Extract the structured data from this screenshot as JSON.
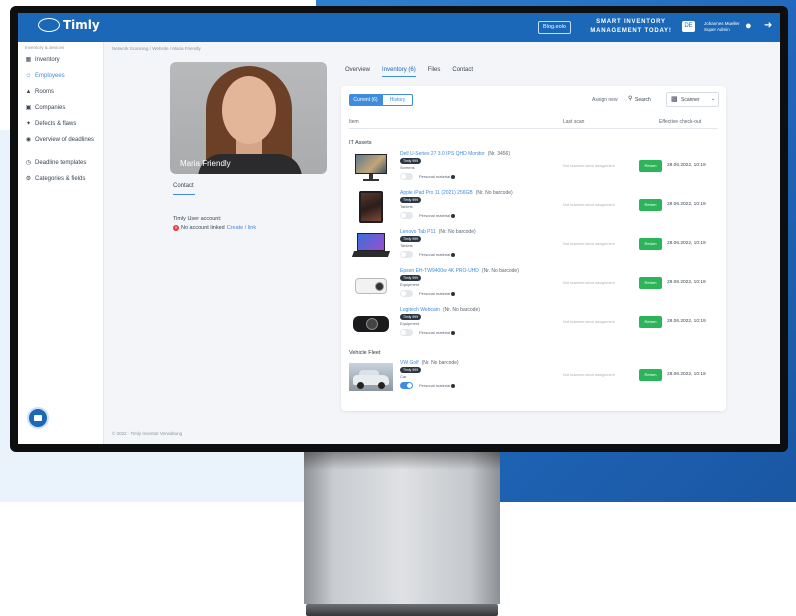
{
  "brand": {
    "name": "Timly",
    "blog_label": "Blog.eolo",
    "tagline": "SMART INVENTORY MANAGEMENT TODAY!",
    "flag": "DE",
    "user_line1": "Johannes Mueller",
    "user_line2": "Super Admin",
    "accent": "#1b67b8",
    "success": "#2bb45a"
  },
  "sidebar": {
    "caption": "Inventory & devices",
    "items": [
      {
        "label": "Inventory",
        "icon": "box-icon"
      },
      {
        "label": "Employees",
        "icon": "employees-icon",
        "active": true
      },
      {
        "label": "Rooms",
        "icon": "room-icon"
      },
      {
        "label": "Companies",
        "icon": "company-icon"
      },
      {
        "label": "Defects & flaws",
        "icon": "wrench-icon"
      },
      {
        "label": "Overview of deadlines",
        "icon": "eye-icon"
      },
      {
        "label": "Deadline templates",
        "icon": "clock-icon"
      },
      {
        "label": "Categories & fields",
        "icon": "gear-icon"
      }
    ]
  },
  "breadcrumb": "Network Scanning  /  Website  /  Maria Friendly",
  "profile": {
    "name": "Maria Friendly",
    "contact_label": "Contact",
    "account_label": "Timly User account:",
    "account_status": "No account linked",
    "account_link": "Create / link"
  },
  "tabs": [
    "Overview",
    "Inventory (6)",
    "Files",
    "Contact"
  ],
  "card": {
    "toggle_current": "Current (6)",
    "toggle_history": "History",
    "assign_label": "Assign new",
    "search_label": "Search",
    "scanner_label": "Scanner",
    "col_item": "Item",
    "col_last_scan": "Last scan",
    "col_checkout": "Effective check-out",
    "groups": [
      {
        "title": "IT Assets",
        "rows": [
          {
            "title": "Dell U-Series 27 3.0 IPS QHD Monitor",
            "code": "(Nr. 3456)",
            "badge": "Timly 999",
            "sub": "Screens",
            "personal": "Personal material",
            "lastscan": "Not scanned since assignment",
            "return": "Return",
            "date": "28.06.2022, 10:19",
            "img": "monitor",
            "switch": false
          },
          {
            "title": "Apple iPad Pro 11 (2021) 256GB",
            "code": "(Nr. No barcode)",
            "badge": "Timly 999",
            "sub": "Tablets",
            "personal": "Personal material",
            "lastscan": "Not scanned since assignment",
            "return": "Return",
            "date": "28.06.2022, 10:19",
            "img": "ipad",
            "switch": false
          },
          {
            "title": "Lenovo Tab P11",
            "code": "(Nr. No barcode)",
            "badge": "Timly 999",
            "sub": "Tablets",
            "personal": "Personal material",
            "lastscan": "Not scanned since assignment",
            "return": "Return",
            "date": "28.06.2022, 10:19",
            "img": "laptop",
            "switch": false
          },
          {
            "title": "Epson EH-TW9400w 4K PRO-UHD",
            "code": "(Nr. No barcode)",
            "badge": "Timly 999",
            "sub": "Equipment",
            "personal": "Personal material",
            "lastscan": "Not scanned since assignment",
            "return": "Return",
            "date": "28.06.2022, 10:19",
            "img": "projector",
            "switch": false
          },
          {
            "title": "Logitech Webcam",
            "code": "(Nr. No barcode)",
            "badge": "Timly 999",
            "sub": "Equipment",
            "personal": "Personal material",
            "lastscan": "Not scanned since assignment",
            "return": "Return",
            "date": "28.06.2022, 10:19",
            "img": "webcam",
            "switch": false
          }
        ]
      },
      {
        "title": "Vehicle Fleet",
        "rows": [
          {
            "title": "VW Golf",
            "code": "(Nr. No barcode)",
            "badge": "Timly 999",
            "sub": "Car",
            "personal": "Personal material",
            "lastscan": "Not scanned since assignment",
            "return": "Return",
            "date": "28.06.2022, 10:19",
            "img": "car",
            "switch": true
          }
        ]
      }
    ]
  },
  "footer": "© 2022 · Timly Inventar Verwaltung"
}
